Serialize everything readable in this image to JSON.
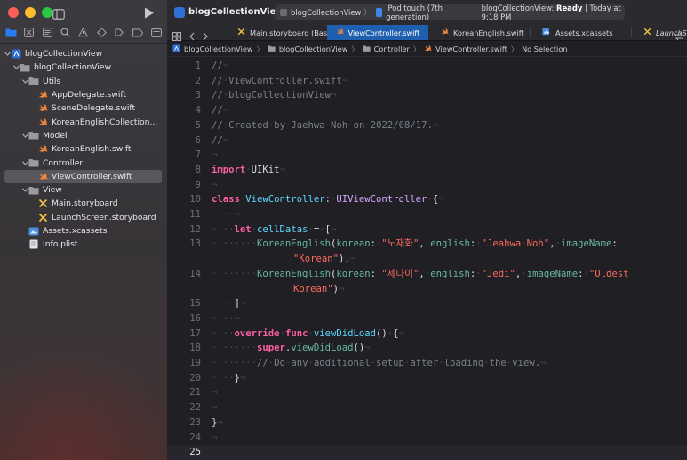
{
  "sidebar": {
    "tree": [
      {
        "label": "blogCollectionView",
        "indent": 0,
        "icon": "project",
        "chevron": "down"
      },
      {
        "label": "blogCollectionView",
        "indent": 1,
        "icon": "folder",
        "chevron": "down"
      },
      {
        "label": "Utils",
        "indent": 2,
        "icon": "folder",
        "chevron": "down"
      },
      {
        "label": "AppDelegate.swift",
        "indent": 3,
        "icon": "swift",
        "chevron": ""
      },
      {
        "label": "SceneDelegate.swift",
        "indent": 3,
        "icon": "swift",
        "chevron": ""
      },
      {
        "label": "KoreanEnglishCollection...",
        "indent": 3,
        "icon": "swift",
        "chevron": ""
      },
      {
        "label": "Model",
        "indent": 2,
        "icon": "folder",
        "chevron": "down"
      },
      {
        "label": "KoreanEnglish.swift",
        "indent": 3,
        "icon": "swift",
        "chevron": ""
      },
      {
        "label": "Controller",
        "indent": 2,
        "icon": "folder",
        "chevron": "down"
      },
      {
        "label": "ViewController.swift",
        "indent": 3,
        "icon": "swift",
        "chevron": "",
        "selected": true
      },
      {
        "label": "View",
        "indent": 2,
        "icon": "folder",
        "chevron": "down"
      },
      {
        "label": "Main.storyboard",
        "indent": 3,
        "icon": "storyboard",
        "chevron": ""
      },
      {
        "label": "LaunchScreen.storyboard",
        "indent": 3,
        "icon": "storyboard",
        "chevron": ""
      },
      {
        "label": "Assets.xcassets",
        "indent": 2,
        "icon": "assets",
        "chevron": ""
      },
      {
        "label": "Info.plist",
        "indent": 2,
        "icon": "plist",
        "chevron": ""
      }
    ]
  },
  "toolbar": {
    "project_title": "blogCollectionView",
    "scheme": "blogCollectionView",
    "destination": "iPod touch (7th generation)",
    "status_prefix": "blogCollectionView: ",
    "status_state": "Ready",
    "status_time": " | Today at 9:18 PM"
  },
  "tabs": [
    {
      "label": "Main.storyboard (Base)",
      "icon": "storyboard"
    },
    {
      "label": "ViewController.swift",
      "icon": "swift",
      "active": true
    },
    {
      "label": "KoreanEnglish.swift",
      "icon": "swift"
    },
    {
      "label": "Assets.xcassets",
      "icon": "assets"
    },
    {
      "label": "LaunchS",
      "icon": "storyboard"
    }
  ],
  "jumpbar": [
    "blogCollectionView",
    "blogCollectionView",
    "Controller",
    "ViewController.swift",
    "No Selection"
  ],
  "editor": {
    "current_line": 25,
    "lines": [
      {
        "n": "1",
        "t": [
          [
            "cm",
            "//"
          ],
          [
            "ws",
            "¬"
          ]
        ]
      },
      {
        "n": "2",
        "t": [
          [
            "cm",
            "//"
          ],
          [
            "ws",
            "·"
          ],
          [
            "cm",
            "ViewController.swift"
          ],
          [
            "ws",
            "¬"
          ]
        ]
      },
      {
        "n": "3",
        "t": [
          [
            "cm",
            "//"
          ],
          [
            "ws",
            "·"
          ],
          [
            "cm",
            "blogCollectionView"
          ],
          [
            "ws",
            "¬"
          ]
        ]
      },
      {
        "n": "4",
        "t": [
          [
            "cm",
            "//"
          ],
          [
            "ws",
            "¬"
          ]
        ]
      },
      {
        "n": "5",
        "t": [
          [
            "cm",
            "//"
          ],
          [
            "ws",
            "·"
          ],
          [
            "cm",
            "Created"
          ],
          [
            "ws",
            "·"
          ],
          [
            "cm",
            "by"
          ],
          [
            "ws",
            "·"
          ],
          [
            "cm",
            "Jaehwa"
          ],
          [
            "ws",
            "·"
          ],
          [
            "cm",
            "Noh"
          ],
          [
            "ws",
            "·"
          ],
          [
            "cm",
            "on"
          ],
          [
            "ws",
            "·"
          ],
          [
            "cm",
            "2022/08/17."
          ],
          [
            "ws",
            "¬"
          ]
        ]
      },
      {
        "n": "6",
        "t": [
          [
            "cm",
            "//"
          ],
          [
            "ws",
            "¬"
          ]
        ]
      },
      {
        "n": "7",
        "t": [
          [
            "ws",
            "¬"
          ]
        ]
      },
      {
        "n": "8",
        "t": [
          [
            "kw",
            "import"
          ],
          [
            "ws",
            "·"
          ],
          [
            "pl",
            "UIKit"
          ],
          [
            "ws",
            "¬"
          ]
        ]
      },
      {
        "n": "9",
        "t": [
          [
            "ws",
            "¬"
          ]
        ]
      },
      {
        "n": "10",
        "t": [
          [
            "kw",
            "class"
          ],
          [
            "ws",
            "·"
          ],
          [
            "dc",
            "ViewController"
          ],
          [
            "pl",
            ":"
          ],
          [
            "ws",
            "·"
          ],
          [
            "ty",
            "UIViewController"
          ],
          [
            "ws",
            "·"
          ],
          [
            "pl",
            "{"
          ],
          [
            "ws",
            "¬"
          ]
        ]
      },
      {
        "n": "11",
        "t": [
          [
            "ws",
            "····¬"
          ]
        ]
      },
      {
        "n": "12",
        "t": [
          [
            "ws",
            "····"
          ],
          [
            "kw",
            "let"
          ],
          [
            "ws",
            "·"
          ],
          [
            "dc",
            "cellDatas"
          ],
          [
            "ws",
            "·"
          ],
          [
            "pl",
            "="
          ],
          [
            "ws",
            "·"
          ],
          [
            "pl",
            "["
          ],
          [
            "ws",
            "¬"
          ]
        ]
      },
      {
        "n": "13",
        "t": [
          [
            "ws",
            "········"
          ],
          [
            "id",
            "KoreanEnglish"
          ],
          [
            "pl",
            "("
          ],
          [
            "id",
            "korean"
          ],
          [
            "pl",
            ":"
          ],
          [
            "ws",
            "·"
          ],
          [
            "st",
            "\"노재화\""
          ],
          [
            "pl",
            ","
          ],
          [
            "ws",
            "·"
          ],
          [
            "id",
            "english"
          ],
          [
            "pl",
            ":"
          ],
          [
            "ws",
            "·"
          ],
          [
            "st",
            "\"Jeahwa"
          ],
          [
            "ws",
            "·"
          ],
          [
            "st",
            "Noh\""
          ],
          [
            "pl",
            ","
          ],
          [
            "ws",
            "·"
          ],
          [
            "id",
            "imageName"
          ],
          [
            "pl",
            ":"
          ]
        ]
      },
      {
        "n": "",
        "c": 1,
        "t": [
          [
            "st",
            "\"Korean\""
          ],
          [
            "pl",
            "),"
          ],
          [
            "ws",
            "¬"
          ]
        ]
      },
      {
        "n": "14",
        "t": [
          [
            "ws",
            "········"
          ],
          [
            "id",
            "KoreanEnglish"
          ],
          [
            "pl",
            "("
          ],
          [
            "id",
            "korean"
          ],
          [
            "pl",
            ":"
          ],
          [
            "ws",
            "·"
          ],
          [
            "st",
            "\"제다이\""
          ],
          [
            "pl",
            ","
          ],
          [
            "ws",
            "·"
          ],
          [
            "id",
            "english"
          ],
          [
            "pl",
            ":"
          ],
          [
            "ws",
            "·"
          ],
          [
            "st",
            "\"Jedi\""
          ],
          [
            "pl",
            ","
          ],
          [
            "ws",
            "·"
          ],
          [
            "id",
            "imageName"
          ],
          [
            "pl",
            ":"
          ],
          [
            "ws",
            "·"
          ],
          [
            "st",
            "\"Oldest"
          ]
        ]
      },
      {
        "n": "",
        "c": 1,
        "t": [
          [
            "st",
            "Korean\""
          ],
          [
            "pl",
            ")"
          ],
          [
            "ws",
            "¬"
          ]
        ]
      },
      {
        "n": "15",
        "t": [
          [
            "ws",
            "····"
          ],
          [
            "pl",
            "]"
          ],
          [
            "ws",
            "¬"
          ]
        ]
      },
      {
        "n": "16",
        "t": [
          [
            "ws",
            "····¬"
          ]
        ]
      },
      {
        "n": "17",
        "t": [
          [
            "ws",
            "····"
          ],
          [
            "kw",
            "override"
          ],
          [
            "ws",
            "·"
          ],
          [
            "kw",
            "func"
          ],
          [
            "ws",
            "·"
          ],
          [
            "dc",
            "viewDidLoad"
          ],
          [
            "pl",
            "()"
          ],
          [
            "ws",
            "·"
          ],
          [
            "pl",
            "{"
          ],
          [
            "ws",
            "¬"
          ]
        ]
      },
      {
        "n": "18",
        "t": [
          [
            "ws",
            "········"
          ],
          [
            "kw",
            "super"
          ],
          [
            "pl",
            "."
          ],
          [
            "fn",
            "viewDidLoad"
          ],
          [
            "pl",
            "()"
          ],
          [
            "ws",
            "¬"
          ]
        ]
      },
      {
        "n": "19",
        "t": [
          [
            "ws",
            "········"
          ],
          [
            "cm",
            "//"
          ],
          [
            "ws",
            "·"
          ],
          [
            "cm",
            "Do"
          ],
          [
            "ws",
            "·"
          ],
          [
            "cm",
            "any"
          ],
          [
            "ws",
            "·"
          ],
          [
            "cm",
            "additional"
          ],
          [
            "ws",
            "·"
          ],
          [
            "cm",
            "setup"
          ],
          [
            "ws",
            "·"
          ],
          [
            "cm",
            "after"
          ],
          [
            "ws",
            "·"
          ],
          [
            "cm",
            "loading"
          ],
          [
            "ws",
            "·"
          ],
          [
            "cm",
            "the"
          ],
          [
            "ws",
            "·"
          ],
          [
            "cm",
            "view."
          ],
          [
            "ws",
            "¬"
          ]
        ]
      },
      {
        "n": "20",
        "t": [
          [
            "ws",
            "····"
          ],
          [
            "pl",
            "}"
          ],
          [
            "ws",
            "¬"
          ]
        ]
      },
      {
        "n": "21",
        "t": [
          [
            "ws",
            "¬"
          ]
        ]
      },
      {
        "n": "22",
        "t": [
          [
            "ws",
            "¬"
          ]
        ]
      },
      {
        "n": "23",
        "t": [
          [
            "pl",
            "}"
          ],
          [
            "ws",
            "¬"
          ]
        ]
      },
      {
        "n": "24",
        "t": [
          [
            "ws",
            "¬"
          ]
        ]
      },
      {
        "n": "25",
        "t": []
      }
    ]
  }
}
